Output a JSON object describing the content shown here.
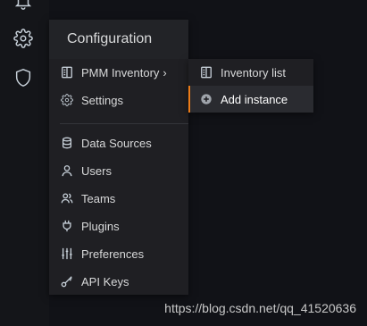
{
  "sidebar": {
    "icons": [
      "bell-icon",
      "gear-icon",
      "shield-icon"
    ]
  },
  "menu": {
    "title": "Configuration",
    "items": [
      {
        "label": "PMM Inventory",
        "icon": "inventory-icon",
        "chevron": "›"
      },
      {
        "label": "Settings",
        "icon": "gear-icon"
      },
      {
        "label": "Data Sources",
        "icon": "database-icon"
      },
      {
        "label": "Users",
        "icon": "user-icon"
      },
      {
        "label": "Teams",
        "icon": "users-icon"
      },
      {
        "label": "Plugins",
        "icon": "plug-icon"
      },
      {
        "label": "Preferences",
        "icon": "sliders-icon"
      },
      {
        "label": "API Keys",
        "icon": "key-icon"
      }
    ]
  },
  "submenu": {
    "items": [
      {
        "label": "Inventory list",
        "icon": "inventory-icon",
        "active": false
      },
      {
        "label": "Add instance",
        "icon": "plus-circle-icon",
        "active": true
      }
    ]
  },
  "colors": {
    "background": "#111217",
    "menu_bg": "#1f1f23",
    "active_accent": "#eb7b18"
  },
  "watermark": "https://blog.csdn.net/qq_41520636"
}
